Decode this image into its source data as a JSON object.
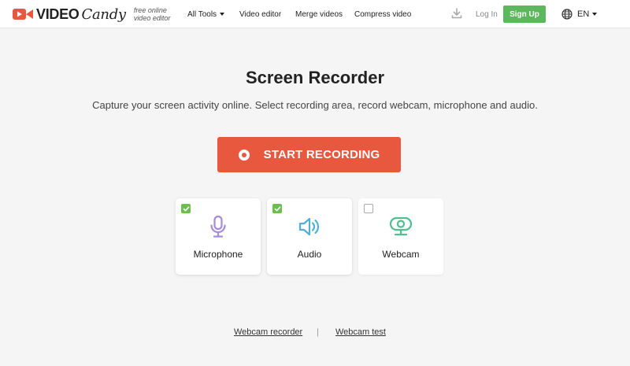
{
  "header": {
    "logo_video": "VIDEO",
    "logo_candy": "Candy",
    "tagline": "free online video editor",
    "nav": {
      "all_tools": "All Tools",
      "video_editor": "Video editor",
      "merge_videos": "Merge videos",
      "compress_video": "Compress video"
    },
    "login": "Log In",
    "signup": "Sign Up",
    "language": "EN"
  },
  "main": {
    "title": "Screen Recorder",
    "subtitle": "Capture your screen activity online. Select recording area, record webcam, microphone and audio.",
    "start_button": "START RECORDING",
    "options": [
      {
        "label": "Microphone",
        "checked": true,
        "icon": "microphone-icon",
        "color": "#a78bd8"
      },
      {
        "label": "Audio",
        "checked": true,
        "icon": "speaker-icon",
        "color": "#4fb0d4"
      },
      {
        "label": "Webcam",
        "checked": false,
        "icon": "webcam-icon",
        "color": "#4fbf8f"
      }
    ]
  },
  "footer": {
    "webcam_recorder": "Webcam recorder",
    "separator": "|",
    "webcam_test": "Webcam test"
  },
  "colors": {
    "accent": "#e8583f",
    "signup": "#5cb85c",
    "check": "#6ac04f",
    "background": "#f5f5f5"
  }
}
